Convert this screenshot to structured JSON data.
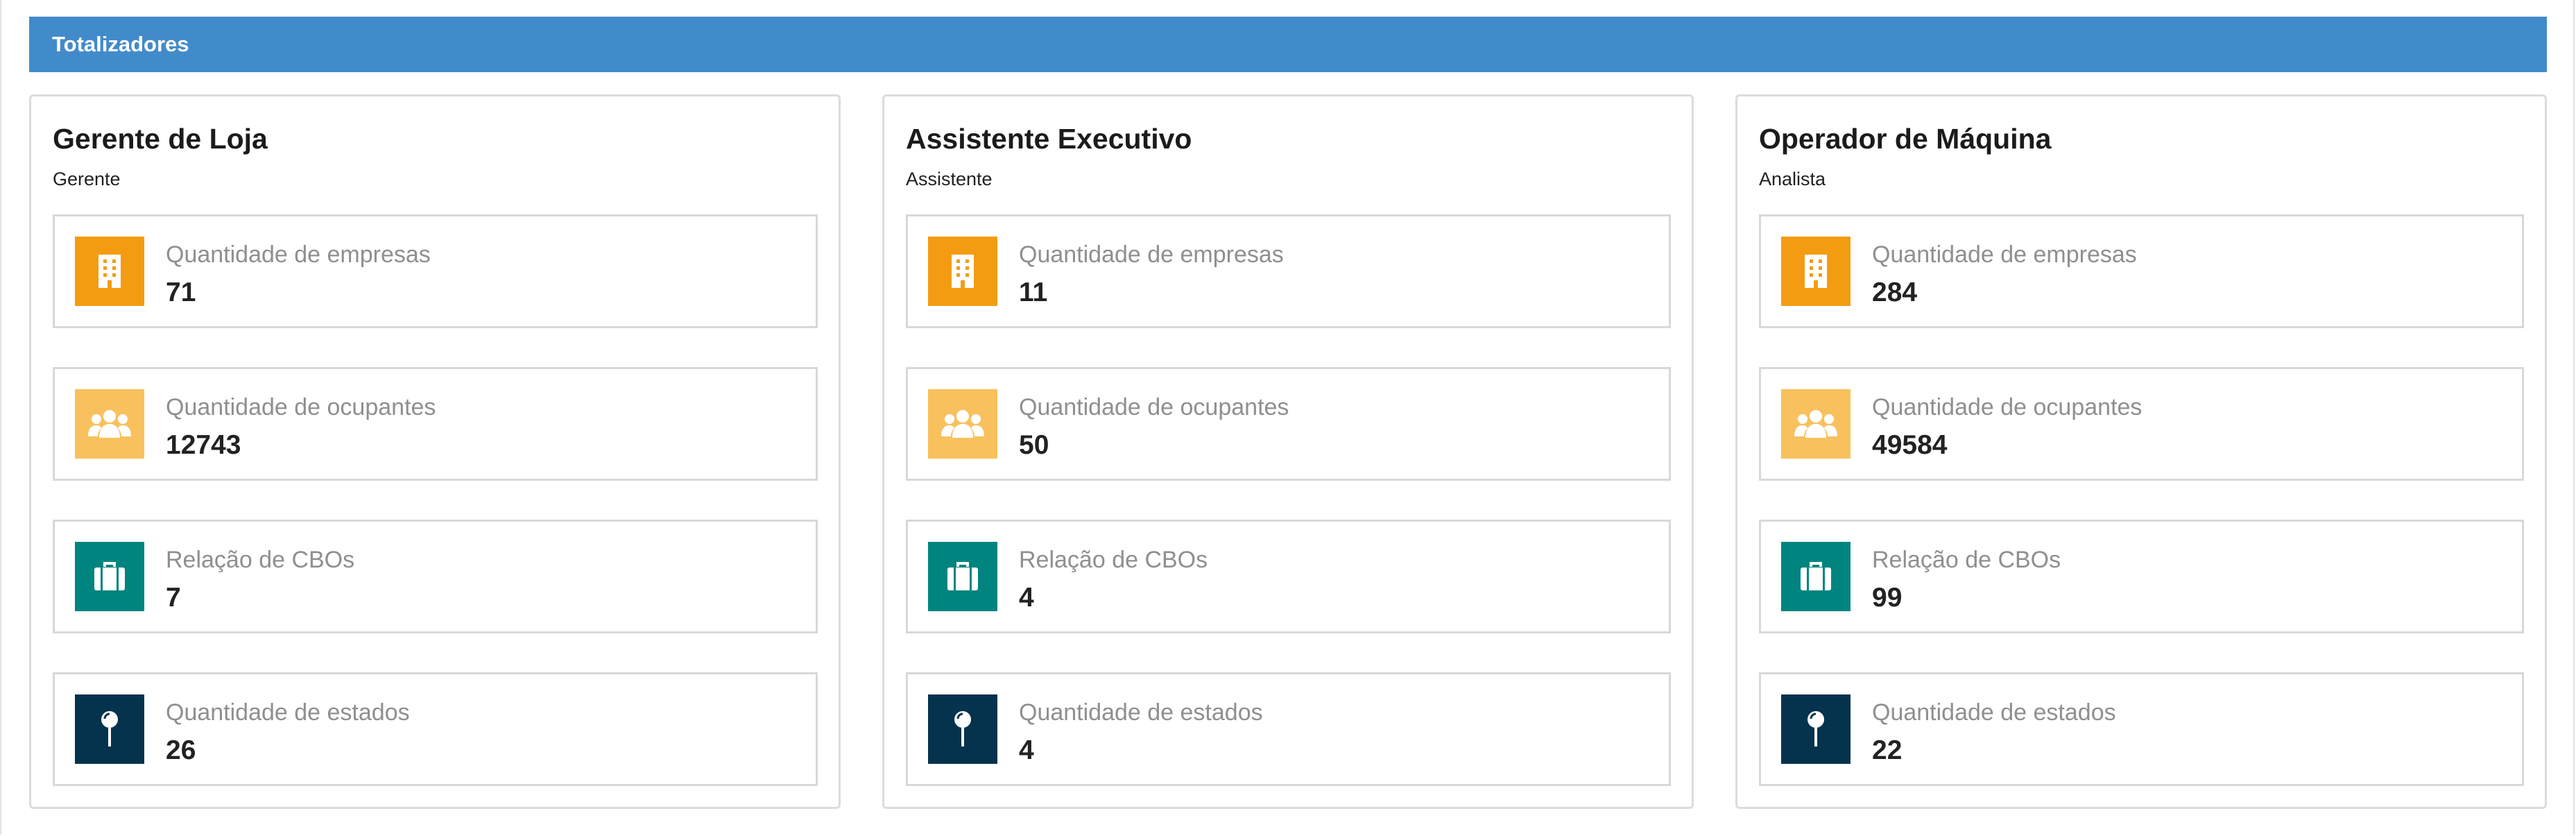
{
  "header": {
    "title": "Totalizadores"
  },
  "colors": {
    "header_bg": "#428bca",
    "empresas_icon_bg": "#f39c12",
    "ocupantes_icon_bg": "#f8c15e",
    "cbos_icon_bg": "#00847f",
    "estados_icon_bg": "#05324d"
  },
  "cards": [
    {
      "title": "Gerente de Loja",
      "subtitle": "Gerente",
      "stats": [
        {
          "label": "Quantidade de empresas",
          "value": "71",
          "icon": "building-icon"
        },
        {
          "label": "Quantidade de ocupantes",
          "value": "12743",
          "icon": "users-icon"
        },
        {
          "label": "Relação de CBOs",
          "value": "7",
          "icon": "suitcase-icon"
        },
        {
          "label": "Quantidade de estados",
          "value": "26",
          "icon": "map-pin-icon"
        }
      ]
    },
    {
      "title": "Assistente Executivo",
      "subtitle": "Assistente",
      "stats": [
        {
          "label": "Quantidade de empresas",
          "value": "11",
          "icon": "building-icon"
        },
        {
          "label": "Quantidade de ocupantes",
          "value": "50",
          "icon": "users-icon"
        },
        {
          "label": "Relação de CBOs",
          "value": "4",
          "icon": "suitcase-icon"
        },
        {
          "label": "Quantidade de estados",
          "value": "4",
          "icon": "map-pin-icon"
        }
      ]
    },
    {
      "title": "Operador de Máquina",
      "subtitle": "Analista",
      "stats": [
        {
          "label": "Quantidade de empresas",
          "value": "284",
          "icon": "building-icon"
        },
        {
          "label": "Quantidade de ocupantes",
          "value": "49584",
          "icon": "users-icon"
        },
        {
          "label": "Relação de CBOs",
          "value": "99",
          "icon": "suitcase-icon"
        },
        {
          "label": "Quantidade de estados",
          "value": "22",
          "icon": "map-pin-icon"
        }
      ]
    }
  ]
}
